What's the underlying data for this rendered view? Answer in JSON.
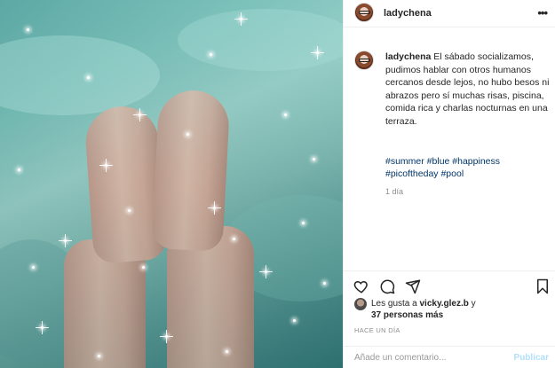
{
  "header": {
    "username": "ladychena",
    "more_label": "•••"
  },
  "caption": {
    "username": "ladychena",
    "text": "El sábado socializamos, pudimos hablar con otros humanos cercanos desde lejos, no hubo besos ni abrazos pero sí muchas risas, piscina, comida rica y charlas nocturnas en una terraza.",
    "hashtags_line1": "#summer #blue #happiness",
    "hashtags_line2": "#picoftheday #pool",
    "age": "1 día"
  },
  "likes": {
    "line1_prefix": "Les gusta a ",
    "liker": "vicky.glez.b",
    "line1_suffix": " y",
    "line2": "37 personas más"
  },
  "timestamp": "HACE UN DÍA",
  "comment": {
    "placeholder": "Añade un comentario...",
    "publish_label": "Publicar"
  },
  "icons": [
    "heart-icon",
    "comment-icon",
    "share-icon",
    "bookmark-icon",
    "more-icon"
  ]
}
